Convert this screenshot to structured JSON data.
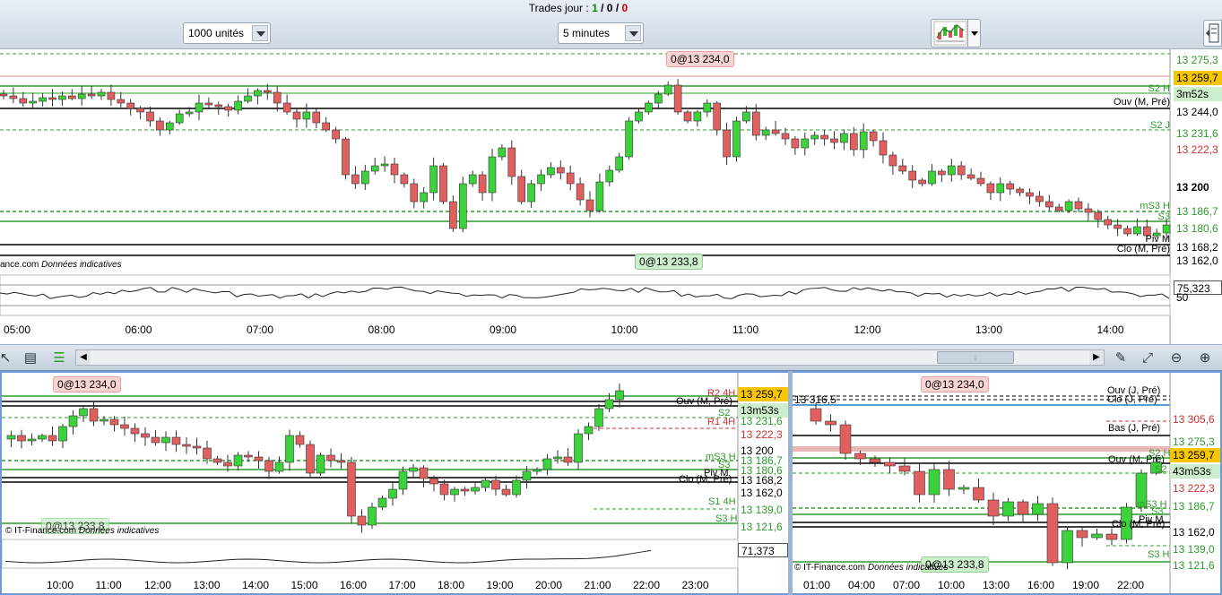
{
  "header": {
    "trades_label": "Trades jour :",
    "trades_win": "1",
    "trades_mid": "0",
    "trades_loss": "0",
    "sep": "/"
  },
  "toolbar": {
    "quantity_value": "1000 unités",
    "interval_value": "5 minutes",
    "chart_type_icon": "candlestick-chart-icon",
    "side_icon": "chart-panel-icon"
  },
  "main_chart": {
    "prices": [
      "13 275,3",
      "13 259,7",
      "3m52s",
      "13 244,0",
      "13 231,6",
      "13 222,3",
      "13 200",
      "13 186,7",
      "13 180,6",
      "13 168,2",
      "13 162,0"
    ],
    "line_labels": [
      "S2 H",
      "Ouv (M, Pré)",
      "S2 J",
      "mS3 H",
      "S3",
      "Piv M",
      "Clo (M, Pré)"
    ],
    "order_top": "0@13 234,0",
    "order_bottom": "0@13 233,8",
    "copyright": "ance.com",
    "data_note": "Données indicatives",
    "indicator_value": "75,323",
    "indicator_level": "50",
    "time_ticks": [
      "05:00",
      "06:00",
      "07:00",
      "08:00",
      "09:00",
      "10:00",
      "11:00",
      "12:00",
      "13:00",
      "14:00"
    ]
  },
  "bottom_left": {
    "prices": [
      "13 259,7",
      "13m53s",
      "13 231,6",
      "13 222,3",
      "13 200",
      "13 186,7",
      "13 180,6",
      "13 168,2",
      "13 162,0",
      "13 139,0",
      "13 121,6"
    ],
    "line_labels": [
      "R2 4H",
      "Ouv (M, Pré)",
      "S2",
      "R1 4H",
      "mS3 H",
      "S3",
      "Piv M",
      "Clo (M, Pré)",
      "S1 4H",
      "S3 H"
    ],
    "order_top": "0@13 234,0",
    "order_bottom": "0@13 233,8",
    "copyright": "© IT-Finance.com",
    "data_note": "Données indicatives",
    "indicator_value": "71,373",
    "time_ticks": [
      "10:00",
      "11:00",
      "12:00",
      "13:00",
      "14:00",
      "15:00",
      "16:00",
      "17:00",
      "18:00",
      "19:00",
      "20:00",
      "21:00",
      "22:00",
      "23:00"
    ]
  },
  "bottom_right": {
    "prices": [
      "13 305,6",
      "13 275,3",
      "13 259,7",
      "43m53s",
      "13 222,3",
      "13 186,7",
      "13 162,0",
      "13 139,0",
      "13 121,6"
    ],
    "line_labels": [
      "Ouv (J, Pré)",
      "Clo (J, Pré)",
      "Bas (J, Pré)",
      "S2 H",
      "Ouv (M, Pré)",
      "S2 J",
      "mS3 H",
      "S3",
      "Piv M",
      "Clo (M, Pré)",
      "S3 H"
    ],
    "top_left_value": "13 316,5",
    "order_top": "0@13 234,0",
    "order_bottom": "0@13 233,8",
    "copyright": "© IT-Finance.com",
    "data_note": "Données indicatives",
    "time_ticks": [
      "01:00",
      "04:00",
      "07:00",
      "10:00",
      "13:00",
      "16:00",
      "19:00",
      "22:00"
    ]
  },
  "colors": {
    "up": "#3cd23c",
    "down": "#e06060",
    "green_line": "#2e9a2e",
    "price_highlight": "#f7c600"
  }
}
